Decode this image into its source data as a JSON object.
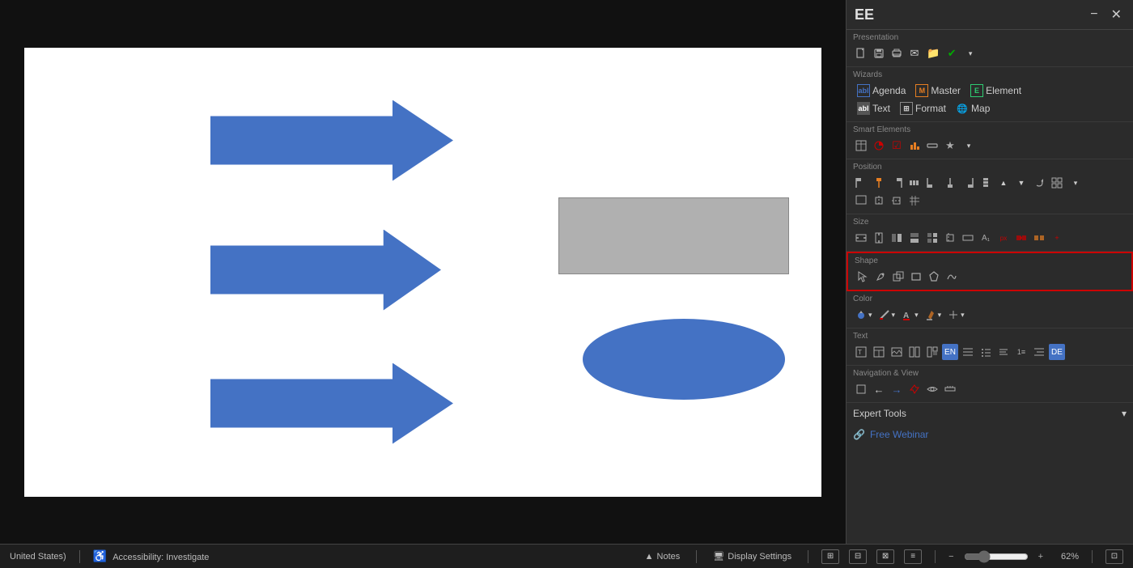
{
  "panel": {
    "title": "EE",
    "minimize_label": "−",
    "close_label": "✕"
  },
  "sections": {
    "presentation": {
      "label": "Presentation",
      "buttons": [
        "💾",
        "🖨",
        "📋",
        "✉",
        "📁",
        "✔"
      ]
    },
    "wizards": {
      "label": "Wizards",
      "agenda_label": "Agenda",
      "master_label": "Master",
      "element_label": "Element",
      "text_label": "Text",
      "format_label": "Format",
      "map_label": "Map"
    },
    "smart_elements": {
      "label": "Smart Elements"
    },
    "position": {
      "label": "Position"
    },
    "size": {
      "label": "Size"
    },
    "shape": {
      "label": "Shape"
    },
    "color": {
      "label": "Color"
    },
    "text": {
      "label": "Text"
    },
    "navigation": {
      "label": "Navigation & View"
    }
  },
  "expert_tools": {
    "label": "Expert Tools",
    "arrow": "▾"
  },
  "free_webinar": {
    "label": "Free Webinar",
    "icon": "🔗"
  },
  "canvas": {
    "arrows": [
      {
        "id": "arrow1"
      },
      {
        "id": "arrow2"
      },
      {
        "id": "arrow3"
      }
    ],
    "rect": {
      "id": "rect1"
    },
    "ellipse": {
      "id": "ellipse1"
    }
  },
  "status_bar": {
    "locale": "United States)",
    "accessibility": "Accessibility: Investigate",
    "notes_label": "Notes",
    "display_settings_label": "Display Settings",
    "zoom_value": "62%"
  }
}
